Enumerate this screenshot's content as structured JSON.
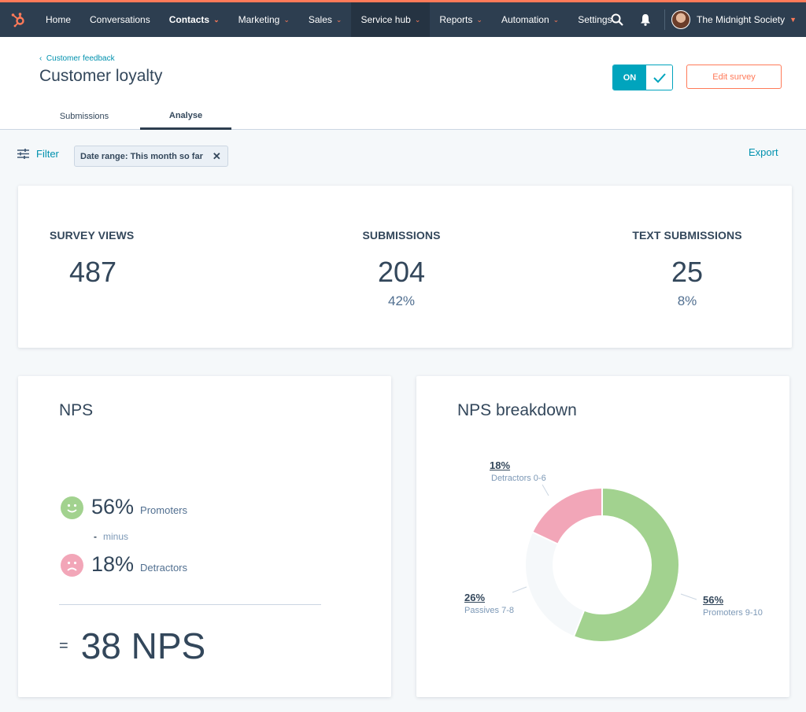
{
  "nav": {
    "items": [
      {
        "label": "Home",
        "bold": false,
        "chevron": false,
        "active": false
      },
      {
        "label": "Conversations",
        "bold": false,
        "chevron": false,
        "active": false
      },
      {
        "label": "Contacts",
        "bold": true,
        "chevron": true,
        "active": false
      },
      {
        "label": "Marketing",
        "bold": false,
        "chevron": true,
        "active": false
      },
      {
        "label": "Sales",
        "bold": false,
        "chevron": true,
        "active": false
      },
      {
        "label": "Service hub",
        "bold": false,
        "chevron": true,
        "active": true
      },
      {
        "label": "Reports",
        "bold": false,
        "chevron": true,
        "active": false
      },
      {
        "label": "Automation",
        "bold": false,
        "chevron": true,
        "active": false
      },
      {
        "label": "Settings",
        "bold": false,
        "chevron": false,
        "active": false
      }
    ],
    "account": "The Midnight Society"
  },
  "header": {
    "breadcrumb": "Customer feedback",
    "title": "Customer loyalty",
    "toggle_label": "ON",
    "edit_button": "Edit survey",
    "tabs": [
      "Submissions",
      "Analyse"
    ],
    "active_tab": "Analyse"
  },
  "filter": {
    "label": "Filter",
    "chip": "Date range: This month so far",
    "export": "Export"
  },
  "stats": {
    "views_label": "SURVEY VIEWS",
    "views_value": "487",
    "submissions_label": "SUBMISSIONS",
    "submissions_value": "204",
    "submissions_pct": "42%",
    "text_label": "TEXT SUBMISSIONS",
    "text_value": "25",
    "text_pct": "8%"
  },
  "nps": {
    "title": "NPS",
    "promoters_pct": "56%",
    "promoters_label": "Promoters",
    "minus_label": "minus",
    "detractors_pct": "18%",
    "detractors_label": "Detractors",
    "total": "38 NPS"
  },
  "breakdown": {
    "title": "NPS breakdown"
  },
  "chart_data": {
    "type": "pie",
    "title": "NPS breakdown",
    "donut": true,
    "slices": [
      {
        "label": "Promoters 9-10",
        "value": 56,
        "display": "56%",
        "color": "#a2d28f"
      },
      {
        "label": "Passives 7-8",
        "value": 26,
        "display": "26%",
        "color": "#f5f8fa"
      },
      {
        "label": "Detractors 0-6",
        "value": 18,
        "display": "18%",
        "color": "#f2a6b8"
      }
    ]
  },
  "colors": {
    "accent": "#ff7a59",
    "link": "#0091ae",
    "nav_bg": "#2d3e50",
    "toggle": "#00a4bd"
  }
}
